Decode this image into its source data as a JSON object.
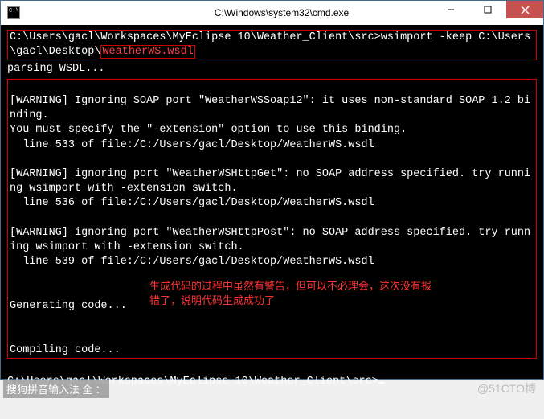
{
  "window": {
    "title": "C:\\Windows\\system32\\cmd.exe"
  },
  "terminal": {
    "box1_line1": "C:\\Users\\gacl\\Workspaces\\MyEclipse 10\\Weather_Client\\src>wsimport -keep C:\\Users",
    "box1_line2_prefix": "\\gacl\\Desktop\\",
    "box1_line2_highlight": "WeatherWS.wsdl",
    "parsing": "parsing WSDL...",
    "warn1_line1": "[WARNING] Ignoring SOAP port \"WeatherWSSoap12\": it uses non-standard SOAP 1.2 bi",
    "warn1_line2": "nding.",
    "warn1_line3": "You must specify the \"-extension\" option to use this binding.",
    "warn1_line4": "  line 533 of file:/C:/Users/gacl/Desktop/WeatherWS.wsdl",
    "warn2_line1": "[WARNING] ignoring port \"WeatherWSHttpGet\": no SOAP address specified. try runni",
    "warn2_line2": "ng wsimport with -extension switch.",
    "warn2_line3": "  line 536 of file:/C:/Users/gacl/Desktop/WeatherWS.wsdl",
    "warn3_line1": "[WARNING] ignoring port \"WeatherWSHttpPost\": no SOAP address specified. try runn",
    "warn3_line2": "ing wsimport with -extension switch.",
    "warn3_line3": "  line 539 of file:/C:/Users/gacl/Desktop/WeatherWS.wsdl",
    "generating": "Generating code...",
    "compiling": "Compiling code...",
    "prompt": "C:\\Users\\gacl\\Workspaces\\MyEclipse 10\\Weather_Client\\src>",
    "annotation_line1": "生成代码的过程中虽然有警告，但可以不必理会，这次没有报",
    "annotation_line2": "错了，说明代码生成成功了"
  },
  "ime": {
    "text": "搜狗拼音输入法 全 ："
  },
  "watermark": {
    "text": "@51CTO博"
  }
}
